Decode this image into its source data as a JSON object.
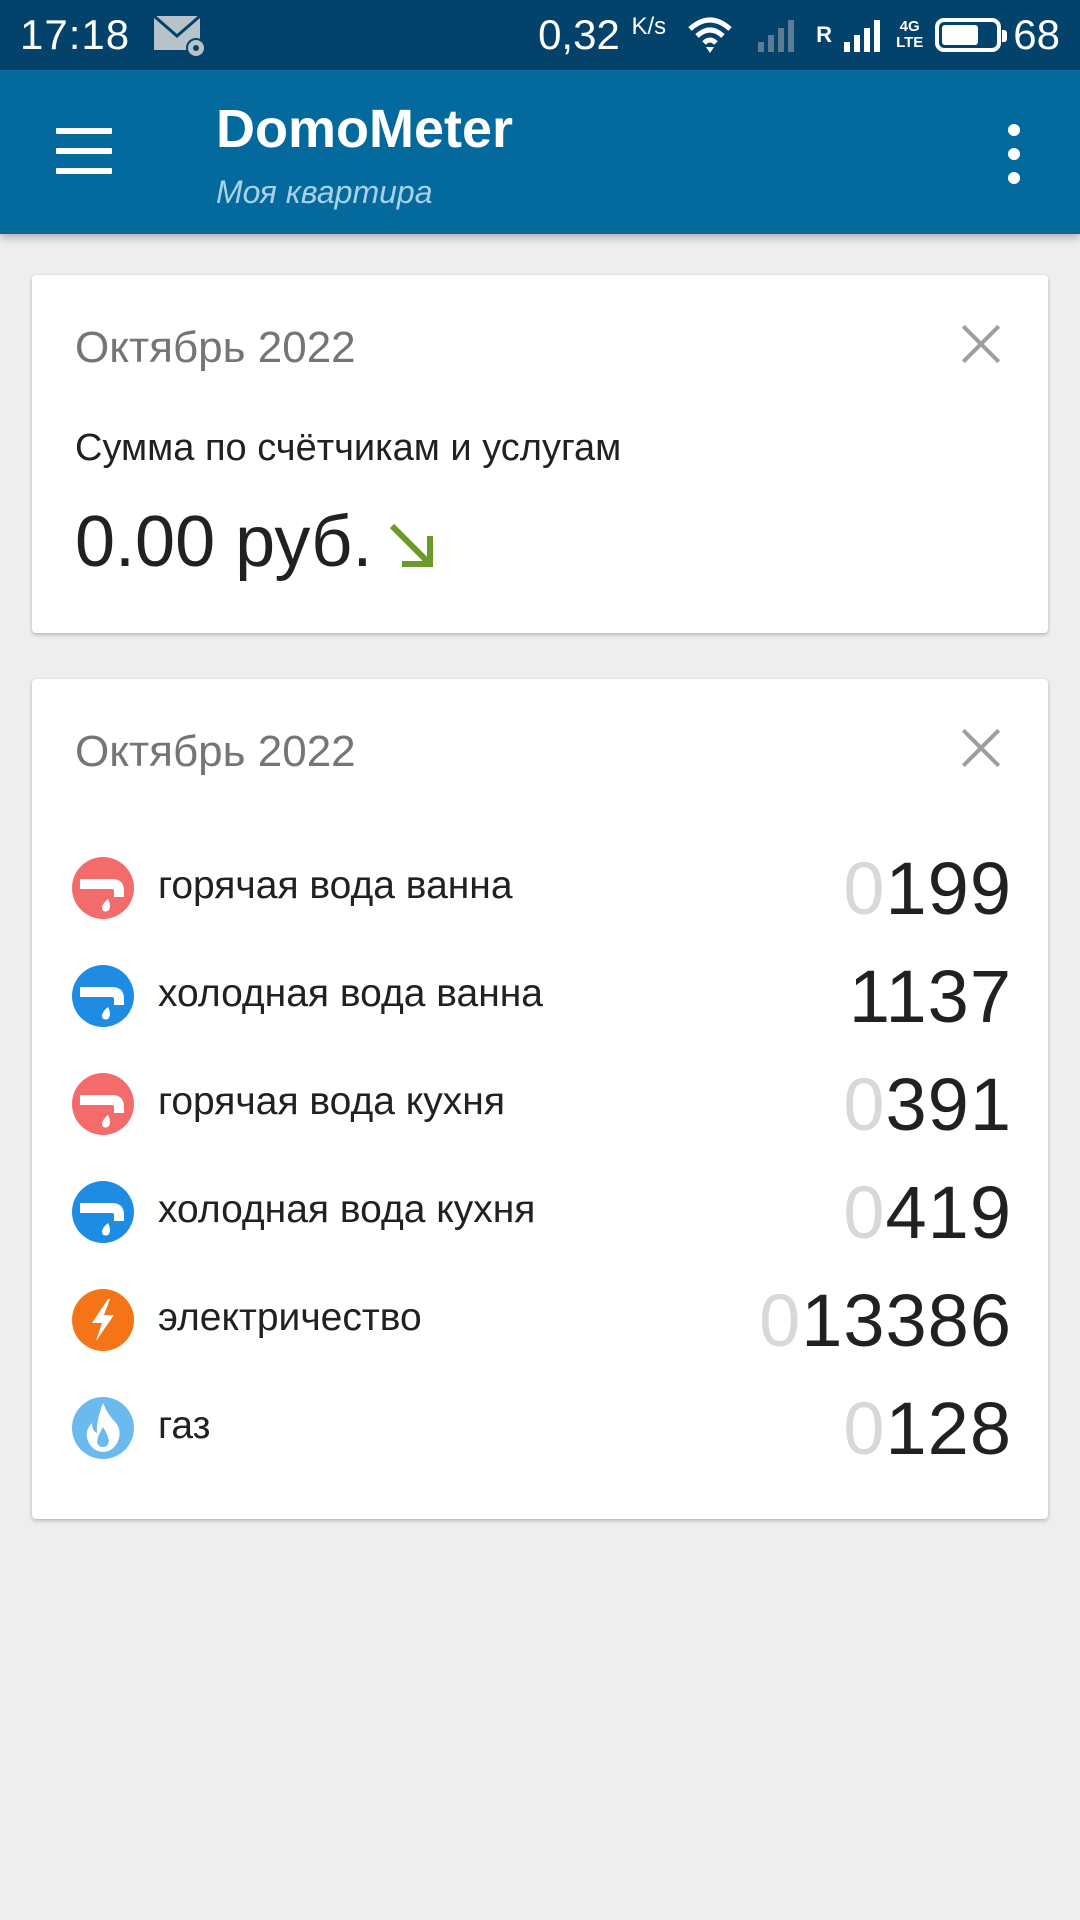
{
  "status_bar": {
    "time": "17:18",
    "speed": "0,32",
    "speed_unit": "K/s",
    "roaming": "R",
    "network_top": "4G",
    "network_bottom": "LTE",
    "battery": "68",
    "battery_level": 0.68
  },
  "app_bar": {
    "title": "DomoMeter",
    "subtitle": "Моя квартира"
  },
  "summary_card": {
    "title": "Октябрь 2022",
    "label": "Сумма по счётчикам и услугам",
    "amount": "0.00 руб.",
    "trend_icon": "arrow-down-right-icon",
    "trend_color": "#6a9a2a"
  },
  "meters_card": {
    "title": "Октябрь 2022",
    "meters": [
      {
        "name": "горячая вода ванна",
        "lead": "0",
        "value": "199",
        "icon": "hot-water-icon",
        "color": "#f46b6b"
      },
      {
        "name": "холодная вода ванна",
        "lead": "",
        "value": "1137",
        "icon": "cold-water-icon",
        "color": "#1e8ce3"
      },
      {
        "name": "горячая вода кухня",
        "lead": "0",
        "value": "391",
        "icon": "hot-water-icon",
        "color": "#f46b6b"
      },
      {
        "name": "холодная вода кухня",
        "lead": "0",
        "value": "419",
        "icon": "cold-water-icon",
        "color": "#1e8ce3"
      },
      {
        "name": "электричество",
        "lead": "0",
        "value": "13386",
        "icon": "electricity-icon",
        "color": "#f57418"
      },
      {
        "name": "газ",
        "lead": "0",
        "value": "128",
        "icon": "gas-icon",
        "color": "#6ab9ef"
      }
    ]
  },
  "colors": {
    "status_bar": "#03426a",
    "app_bar": "#046a9d",
    "background": "#eeeeee"
  }
}
